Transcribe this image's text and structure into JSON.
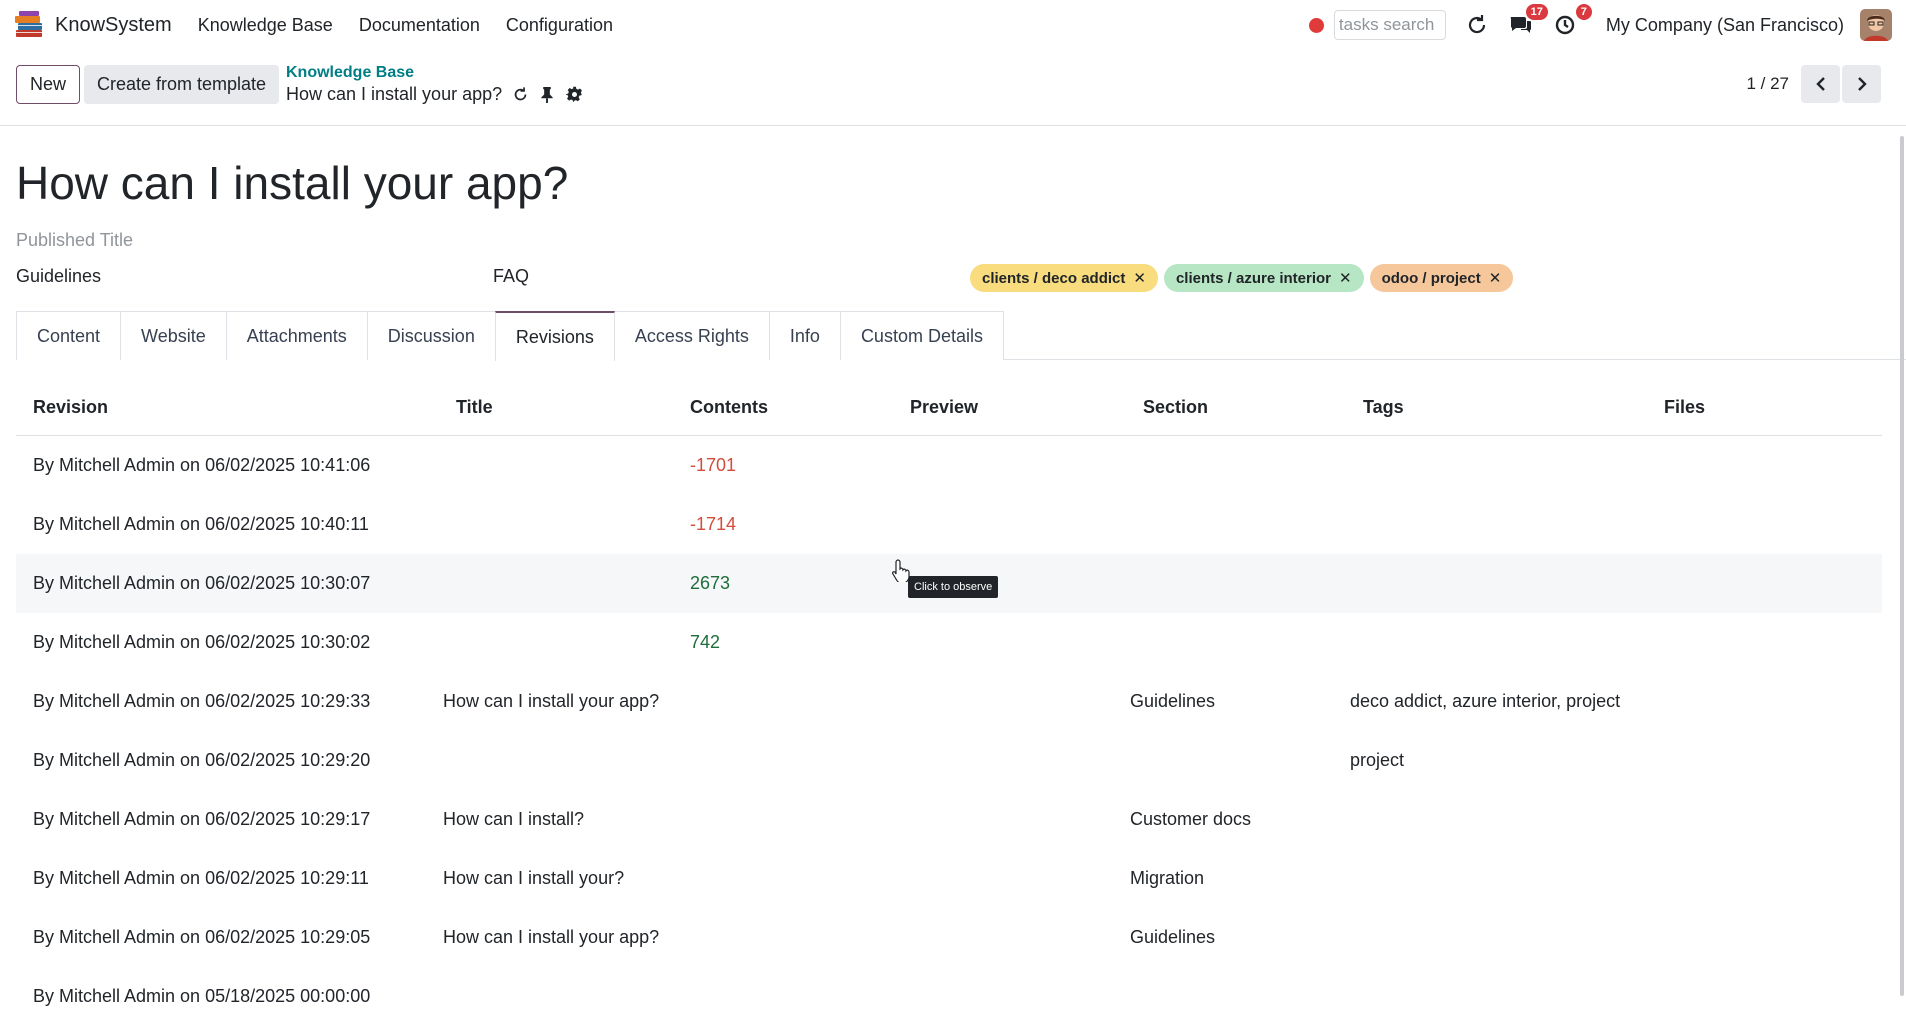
{
  "app": {
    "name": "KnowSystem",
    "menu": [
      "Knowledge Base",
      "Documentation",
      "Configuration"
    ]
  },
  "navbar": {
    "search_placeholder": "tasks search",
    "messages_badge": "17",
    "activities_badge": "7",
    "company": "My Company (San Francisco)",
    "icons": [
      "recording-dot-icon",
      "refresh-icon",
      "chat-icon",
      "clock-icon",
      "avatar"
    ]
  },
  "control": {
    "new_label": "New",
    "template_label": "Create from template",
    "breadcrumb_parent": "Knowledge Base",
    "breadcrumb_current": "How can I install your app?",
    "pager": "1 / 27"
  },
  "form": {
    "title": "How can I install your app?",
    "published_title_placeholder": "Published Title",
    "section": "Guidelines",
    "type": "FAQ",
    "tags": [
      {
        "label": "clients / deco addict",
        "color": "#f8dc7e"
      },
      {
        "label": "clients / azure interior",
        "color": "#b7e6c4"
      },
      {
        "label": "odoo / project",
        "color": "#f5c79a"
      }
    ]
  },
  "tabs": [
    "Content",
    "Website",
    "Attachments",
    "Discussion",
    "Revisions",
    "Access Rights",
    "Info",
    "Custom Details"
  ],
  "active_tab": "Revisions",
  "revisions": {
    "headers": [
      "Revision",
      "Title",
      "Contents",
      "Preview",
      "Section",
      "Tags",
      "Files"
    ],
    "rows": [
      {
        "revision": "By Mitchell Admin on 06/02/2025 10:41:06",
        "title": "",
        "contents": "-1701",
        "preview": "",
        "section": "",
        "tags": "",
        "files": ""
      },
      {
        "revision": "By Mitchell Admin on 06/02/2025 10:40:11",
        "title": "",
        "contents": "-1714",
        "preview": "",
        "section": "",
        "tags": "",
        "files": ""
      },
      {
        "revision": "By Mitchell Admin on 06/02/2025 10:30:07",
        "title": "",
        "contents": "2673",
        "preview": "",
        "section": "",
        "tags": "",
        "files": ""
      },
      {
        "revision": "By Mitchell Admin on 06/02/2025 10:30:02",
        "title": "",
        "contents": "742",
        "preview": "",
        "section": "",
        "tags": "",
        "files": ""
      },
      {
        "revision": "By Mitchell Admin on 06/02/2025 10:29:33",
        "title": "How can I install your app?",
        "contents": "",
        "preview": "",
        "section": "Guidelines",
        "tags": "deco addict, azure interior, project",
        "files": ""
      },
      {
        "revision": "By Mitchell Admin on 06/02/2025 10:29:20",
        "title": "",
        "contents": "",
        "preview": "",
        "section": "",
        "tags": "project",
        "files": ""
      },
      {
        "revision": "By Mitchell Admin on 06/02/2025 10:29:17",
        "title": "How can I install?",
        "contents": "",
        "preview": "",
        "section": "Customer docs",
        "tags": "",
        "files": ""
      },
      {
        "revision": "By Mitchell Admin on 06/02/2025 10:29:11",
        "title": "How can I install your?",
        "contents": "",
        "preview": "",
        "section": "Migration",
        "tags": "",
        "files": ""
      },
      {
        "revision": "By Mitchell Admin on 06/02/2025 10:29:05",
        "title": "How can I install your app?",
        "contents": "",
        "preview": "",
        "section": "Guidelines",
        "tags": "",
        "files": ""
      },
      {
        "revision": "By Mitchell Admin on 05/18/2025 00:00:00",
        "title": "",
        "contents": "",
        "preview": "",
        "section": "",
        "tags": "",
        "files": ""
      }
    ]
  },
  "tooltip": "Click to observe",
  "colors": {
    "accent": "#714b67",
    "link": "#017e84",
    "negative": "#d44c3b",
    "positive": "#1f6d3a",
    "badge": "#d9393f"
  }
}
